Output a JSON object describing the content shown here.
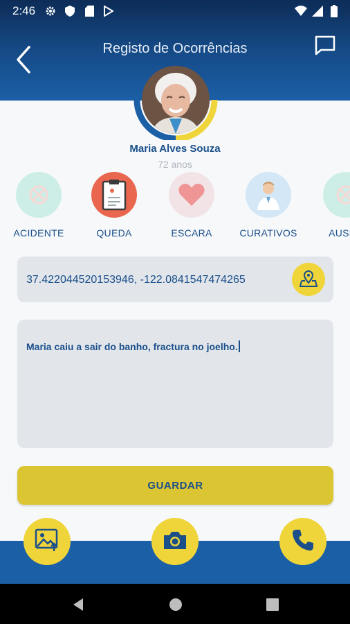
{
  "status_bar": {
    "time": "2:46",
    "left_icons": [
      "gear-icon",
      "shield-icon",
      "sd-card-icon",
      "play-store-icon"
    ],
    "right_icons": [
      "wifi-icon",
      "signal-icon",
      "battery-icon"
    ]
  },
  "header": {
    "title": "Registo de Ocorrências",
    "back_icon": "chevron-left-icon",
    "chat_icon": "chat-bubble-icon"
  },
  "person": {
    "name": "Maria Alves Souza",
    "age": "72 anos"
  },
  "categories": [
    {
      "label": "ACIDENTE",
      "icon": "accident-icon",
      "color": "#cdeee7"
    },
    {
      "label": "QUEDA",
      "icon": "clipboard-icon",
      "color": "#e9664f"
    },
    {
      "label": "ESCARA",
      "icon": "heart-icon",
      "color": "#f2e4e6"
    },
    {
      "label": "CURATIVOS",
      "icon": "doctor-icon",
      "color": "#d3e7f6"
    },
    {
      "label": "AUSEN",
      "icon": "absence-icon",
      "color": "#cdeee7"
    }
  ],
  "location": {
    "coords": "37.422044520153946, -122.0841547474265",
    "map_icon": "map-pin-icon"
  },
  "description": {
    "text": "Maria caiu a sair do banho, fractura no joelho."
  },
  "save_label": "GUARDAR",
  "bottom_actions": [
    "image-upload-icon",
    "camera-icon",
    "phone-icon"
  ],
  "colors": {
    "primary_blue": "#1b5fa6",
    "header_dark": "#0d2c57",
    "accent_yellow": "#f0d53a",
    "text_blue": "#1a4f8a"
  }
}
